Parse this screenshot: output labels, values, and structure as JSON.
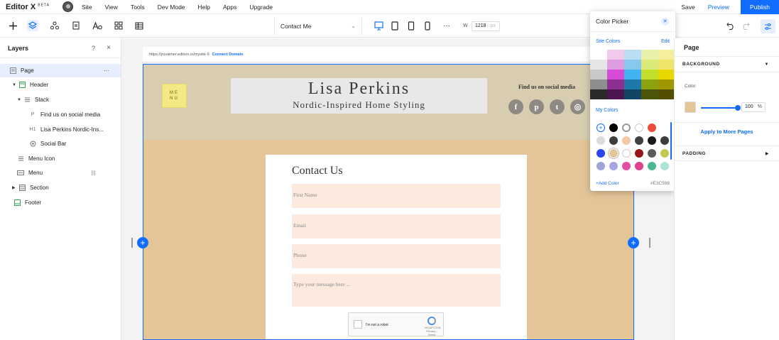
{
  "topbar": {
    "logo": "Editor X",
    "logo_beta": "BETA",
    "menu": [
      "Site",
      "View",
      "Tools",
      "Dev Mode",
      "Help",
      "Apps",
      "Upgrade"
    ],
    "save": "Save",
    "preview": "Preview",
    "publish": "Publish"
  },
  "toolbar": {
    "page": "Contact Me",
    "width_label": "W",
    "width_value": "1218",
    "width_unit": "px",
    "more": "···"
  },
  "layers": {
    "title": "Layers",
    "help": "?",
    "close": "×",
    "items": [
      {
        "label": "Page",
        "arrow": "",
        "icon": "page-icon"
      },
      {
        "label": "Header",
        "arrow": "▼",
        "icon": "header-icon"
      },
      {
        "label": "Stack",
        "arrow": "▼",
        "icon": "stack-icon"
      },
      {
        "label": "Find us on social media",
        "arrow": "",
        "icon": "paragraph-icon"
      },
      {
        "label": "Lisa Perkins Nordic-Ins...",
        "arrow": "",
        "icon": "heading-icon"
      },
      {
        "label": "Social Bar",
        "arrow": "",
        "icon": "social-bar-icon"
      },
      {
        "label": "Menu Icon",
        "arrow": "",
        "icon": "menu-icon"
      },
      {
        "label": "Menu",
        "arrow": "",
        "icon": "menu-bar-icon"
      },
      {
        "label": "Section",
        "arrow": "▶",
        "icon": "section-icon"
      },
      {
        "label": "Footer",
        "arrow": "",
        "icon": "footer-icon"
      }
    ]
  },
  "canvas": {
    "url": "https://yuvalmer.editorx.io/mysite-9",
    "connect_domain": "Connect Domain",
    "site_title": "Lisa Perkins",
    "site_subtitle": "Nordic-Inspired Home Styling",
    "menu_line1": "ME",
    "menu_line2": "NU",
    "social_title": "Find us on social media",
    "social_icons": [
      "f",
      "p",
      "t",
      "◎"
    ],
    "contact_title": "Contact Us",
    "fields": {
      "first_name": "First Name",
      "email": "Email",
      "phone": "Phone",
      "message": "Type your message here ..."
    },
    "captcha_label": "I'm not a robot",
    "captcha_brand": "reCAPTCHA",
    "captcha_links": "Privacy - Terms"
  },
  "picker": {
    "title": "Color Picker",
    "site_colors": "Site Colors",
    "edit": "Edit",
    "my_colors": "My Colors",
    "add_color": "+Add Color",
    "hex": "#E3C598",
    "grid": [
      [
        "#ffffff",
        "#f0c9eb",
        "#b9ddf3",
        "#e8f1a9",
        "#f5ee9a"
      ],
      [
        "#e6e6e6",
        "#e09ce0",
        "#86c8ee",
        "#d9ea78",
        "#f0e56b"
      ],
      [
        "#c8c8c8",
        "#d54ad6",
        "#40b3f0",
        "#c4df2a",
        "#e6d800"
      ],
      [
        "#8e8e8e",
        "#8e2f92",
        "#1e78aa",
        "#8ea211",
        "#a09600"
      ],
      [
        "#2a2a2a",
        "#4d1650",
        "#124563",
        "#4b5608",
        "#544f00"
      ]
    ],
    "my_colors_rows": [
      [
        "#ffffff",
        "#000000",
        "#ffffff",
        "#ffffff",
        "#e84d3d"
      ],
      [
        "#dcdcdc",
        "#3d3d3d",
        "#f5c9a4",
        "#404040",
        "#1a1a1a",
        "#3d3d3d"
      ],
      [
        "#2845f0",
        "#e3c598",
        "#ffffff",
        "#9a1414",
        "#5a5a5a",
        "#c3c84f"
      ],
      [
        "#9fa4d8",
        "#a7a4e2",
        "#e04fa4",
        "#e0408d",
        "#4ab893",
        "#aae4d7"
      ]
    ]
  },
  "inspector": {
    "title": "Page",
    "background": "BACKGROUND",
    "color_label": "Color",
    "opacity": "100",
    "opacity_unit": "%",
    "apply": "Apply to More Pages",
    "padding": "PADDING"
  },
  "colors": {
    "accent": "#116dff",
    "site_bg": "#e3c598",
    "header_bg": "#d8cdb1",
    "field_bg": "#fdeadf"
  }
}
